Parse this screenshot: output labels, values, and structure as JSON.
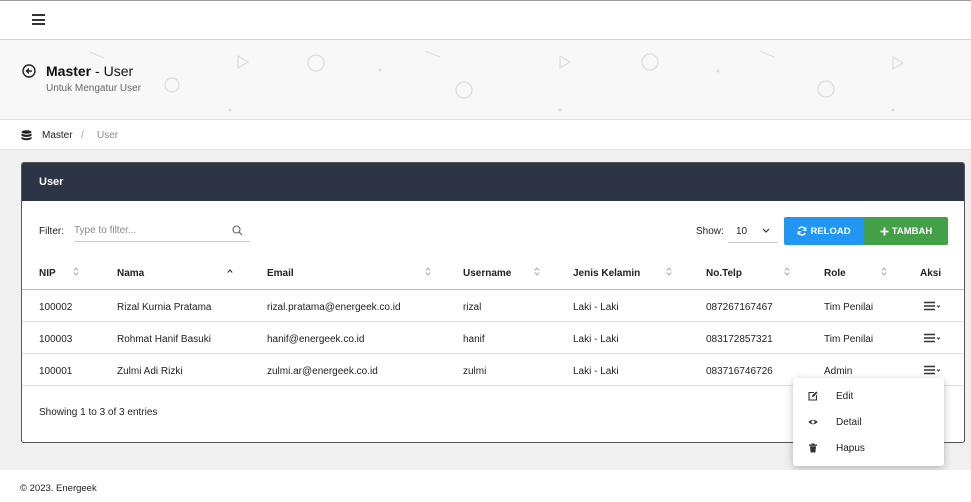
{
  "header": {
    "title_bold": "Master",
    "title_rest": " - User",
    "subtitle": "Untuk Mengatur User"
  },
  "breadcrumb": {
    "items": [
      "Master",
      "User"
    ],
    "separator": "/"
  },
  "card": {
    "title": "User"
  },
  "toolbar": {
    "filter_label": "Filter:",
    "filter_placeholder": "Type to filter...",
    "show_label": "Show:",
    "show_value": "10",
    "reload_label": "RELOAD",
    "tambah_label": "TAMBAH"
  },
  "table": {
    "columns": [
      "NIP",
      "Nama",
      "Email",
      "Username",
      "Jenis Kelamin",
      "No.Telp",
      "Role",
      "Aksi"
    ],
    "rows": [
      [
        "100002",
        "Rizal Kurnia Pratama",
        "rizal.pratama@energeek.co.id",
        "rizal",
        "Laki - Laki",
        "087267167467",
        "Tim Penilai"
      ],
      [
        "100003",
        "Rohmat Hanif Basuki",
        "hanif@energeek.co.id",
        "hanif",
        "Laki - Laki",
        "083172857321",
        "Tim Penilai"
      ],
      [
        "100001",
        "Zulmi Adi Rizki",
        "zulmi.ar@energeek.co.id",
        "zulmi",
        "Laki - Laki",
        "083716746726",
        "Admin"
      ]
    ]
  },
  "entries_text": "Showing 1 to 3 of 3 entries",
  "dropdown": {
    "items": [
      "Edit",
      "Detail",
      "Hapus"
    ]
  },
  "footer": {
    "text": "© 2023. Energeek"
  },
  "colors": {
    "card_header": "#2d3446",
    "reload": "#2196f3",
    "tambah": "#43a047"
  },
  "icons": {
    "menu": "hamburger-icon",
    "back": "circle-arrow-left-icon",
    "breadcrumb": "database-icon",
    "search": "search-icon",
    "reload": "refresh-icon",
    "tambah": "plus-icon",
    "edit": "edit-icon",
    "detail": "eye-icon",
    "hapus": "trash-icon"
  }
}
